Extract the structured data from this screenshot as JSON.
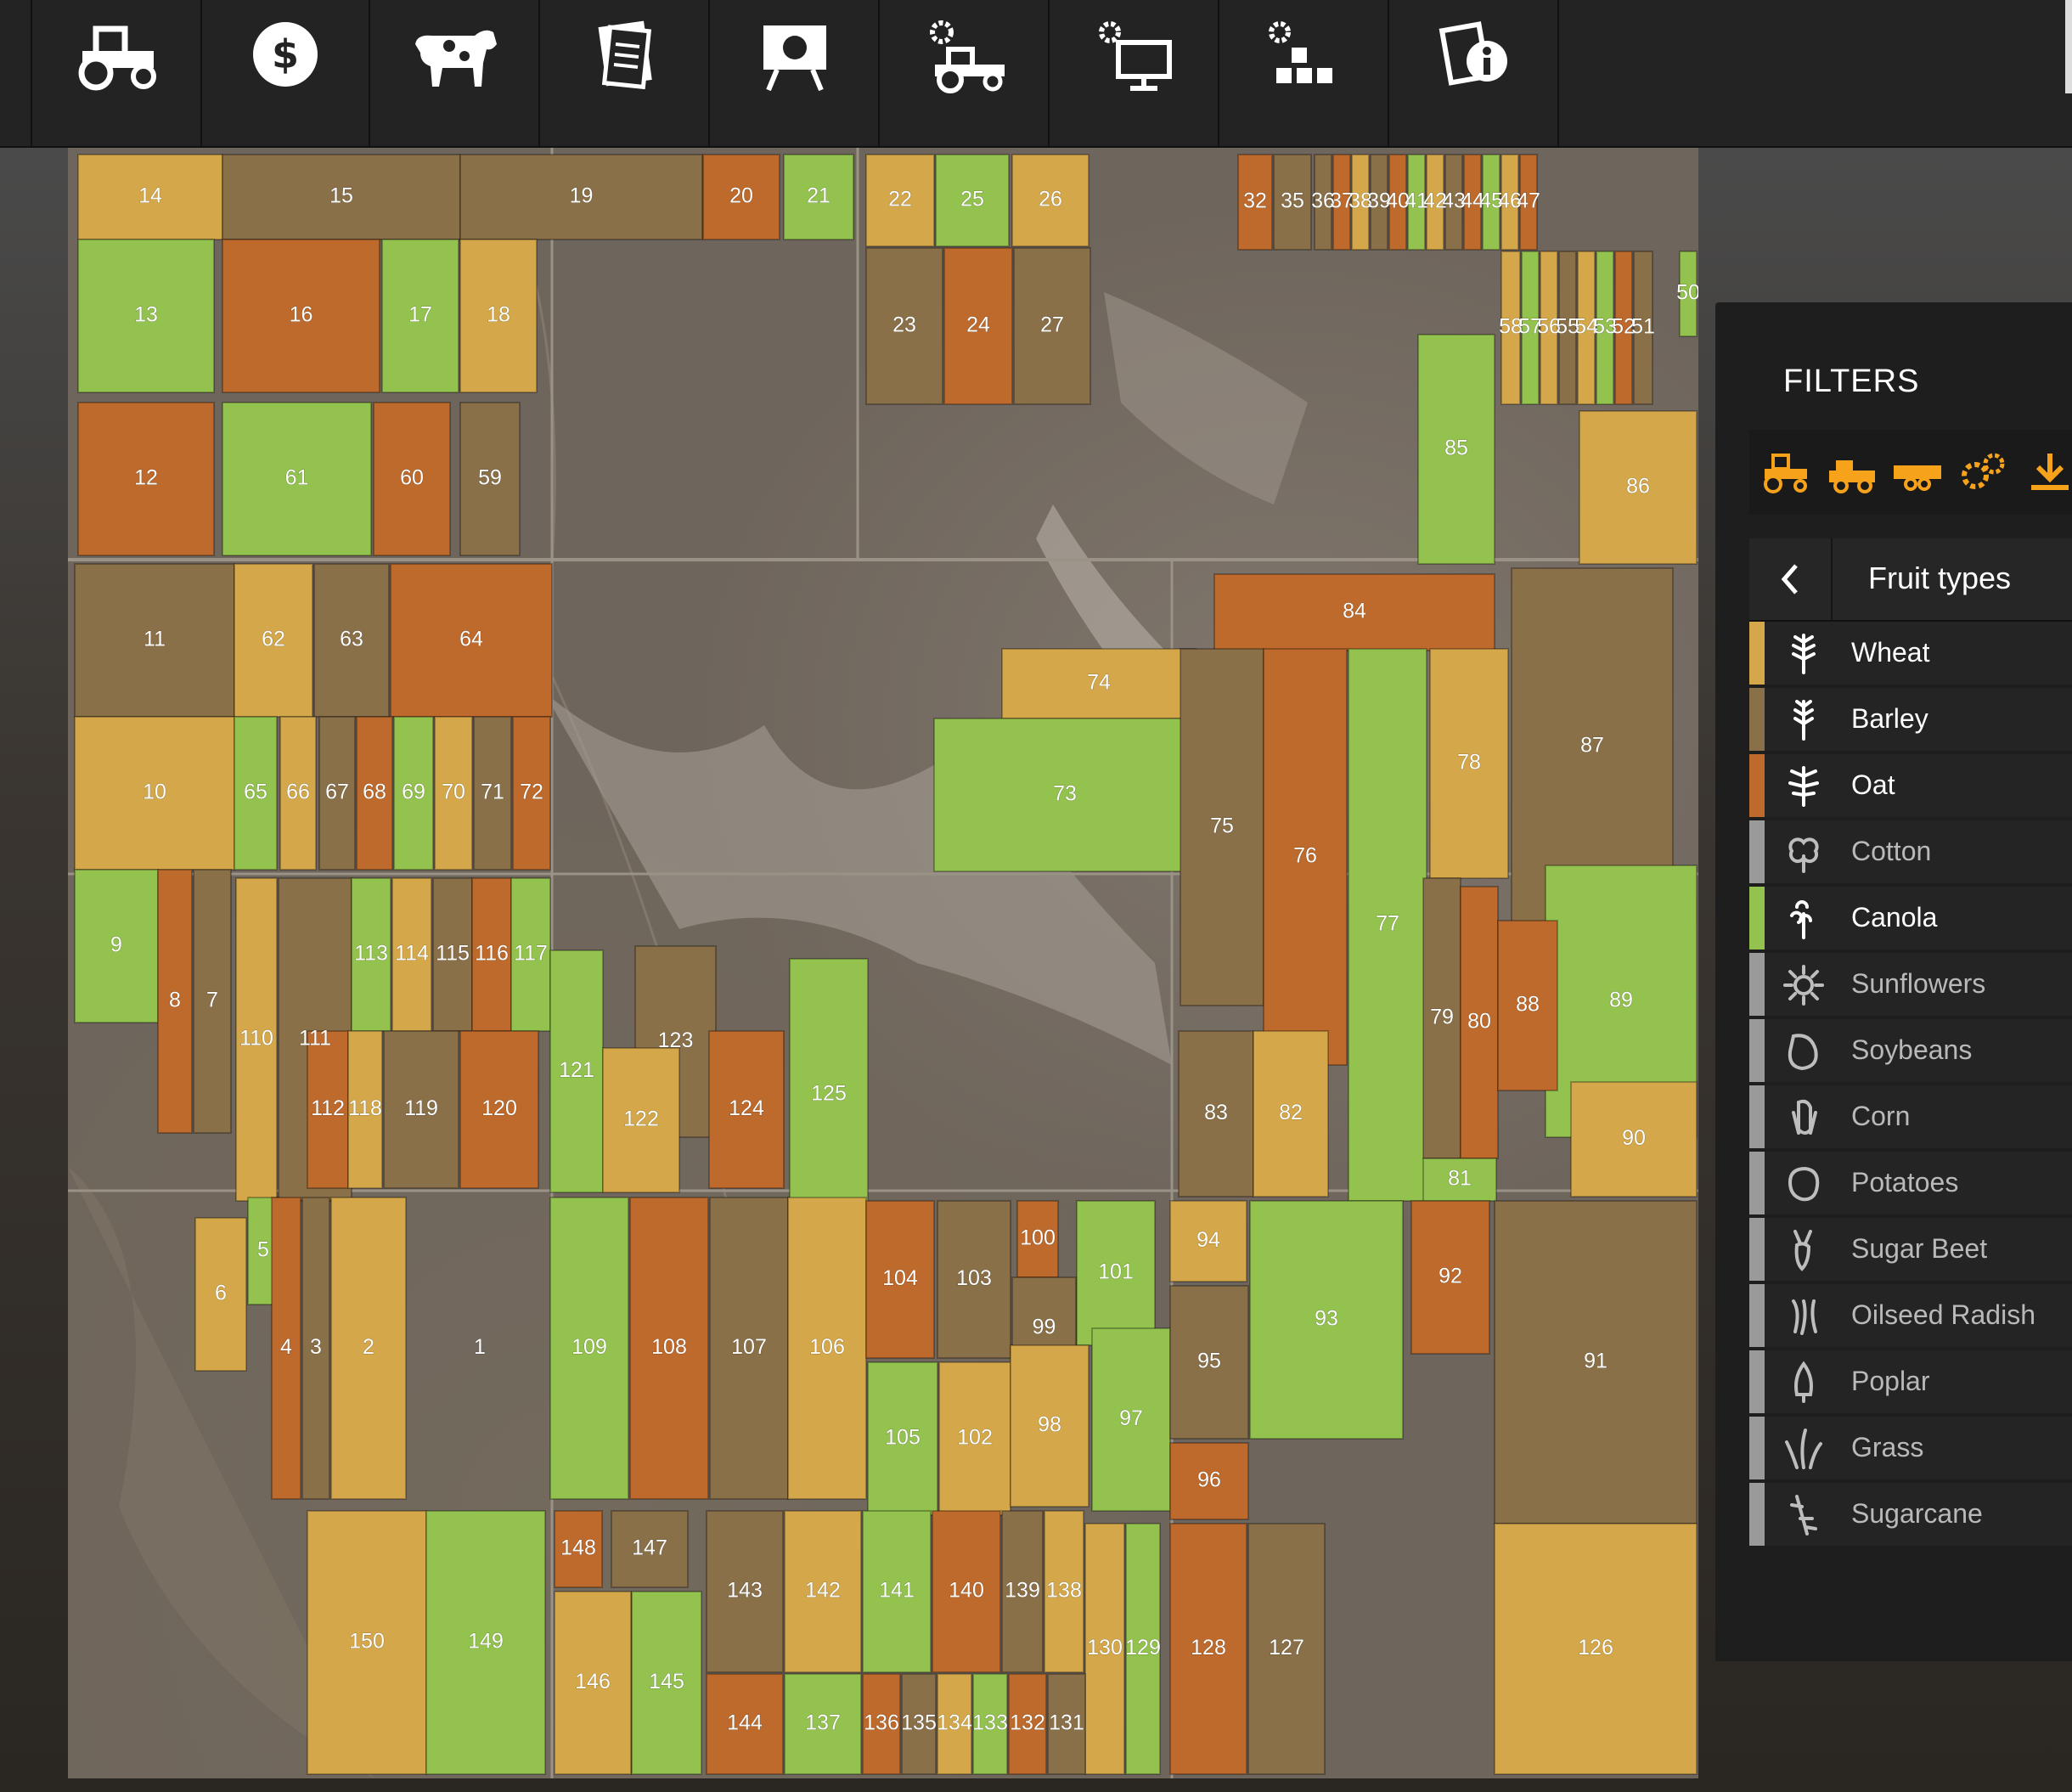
{
  "toolbar": {
    "buttons": [
      {
        "name": "vehicles-icon"
      },
      {
        "name": "finances-icon"
      },
      {
        "name": "animals-icon"
      },
      {
        "name": "contracts-icon"
      },
      {
        "name": "statistics-icon"
      },
      {
        "name": "garage-icon"
      },
      {
        "name": "production-icon"
      },
      {
        "name": "construction-icon"
      },
      {
        "name": "help-icon"
      }
    ]
  },
  "filters": {
    "title": "FILTERS",
    "icons": [
      "tractor-icon",
      "harvester-icon",
      "trailer-icon",
      "gears-icon",
      "download-icon"
    ],
    "icon_color": "#f7a21b",
    "fruit_header": {
      "title": "Fruit types"
    },
    "fruit_types": [
      {
        "label": "Wheat",
        "color": "#d4a84a",
        "active": true,
        "icon": "wheat-icon"
      },
      {
        "label": "Barley",
        "color": "#8a7048",
        "active": true,
        "icon": "barley-icon"
      },
      {
        "label": "Oat",
        "color": "#bd6a2c",
        "active": true,
        "icon": "oat-icon"
      },
      {
        "label": "Cotton",
        "color": "#9a9a9a",
        "active": false,
        "icon": "cotton-icon"
      },
      {
        "label": "Canola",
        "color": "#93c24f",
        "active": true,
        "icon": "canola-icon"
      },
      {
        "label": "Sunflowers",
        "color": "#9a9a9a",
        "active": false,
        "icon": "sunflower-icon"
      },
      {
        "label": "Soybeans",
        "color": "#9a9a9a",
        "active": false,
        "icon": "soybean-icon"
      },
      {
        "label": "Corn",
        "color": "#9a9a9a",
        "active": false,
        "icon": "corn-icon"
      },
      {
        "label": "Potatoes",
        "color": "#9a9a9a",
        "active": false,
        "icon": "potato-icon"
      },
      {
        "label": "Sugar Beet",
        "color": "#9a9a9a",
        "active": false,
        "icon": "sugarbeet-icon"
      },
      {
        "label": "Oilseed Radish",
        "color": "#9a9a9a",
        "active": false,
        "icon": "radish-icon"
      },
      {
        "label": "Poplar",
        "color": "#9a9a9a",
        "active": false,
        "icon": "poplar-icon"
      },
      {
        "label": "Grass",
        "color": "#9a9a9a",
        "active": false,
        "icon": "grass-icon"
      },
      {
        "label": "Sugarcane",
        "color": "#9a9a9a",
        "active": false,
        "icon": "sugarcane-icon"
      }
    ]
  },
  "map": {
    "fields": [
      {
        "id": "14",
        "crop": "W"
      },
      {
        "id": "15",
        "crop": "B"
      },
      {
        "id": "19",
        "crop": "B"
      },
      {
        "id": "20",
        "crop": "O"
      },
      {
        "id": "21",
        "crop": "C"
      },
      {
        "id": "22",
        "crop": "W"
      },
      {
        "id": "25",
        "crop": "C"
      },
      {
        "id": "26",
        "crop": "W"
      },
      {
        "id": "13",
        "crop": "C"
      },
      {
        "id": "16",
        "crop": "O"
      },
      {
        "id": "17",
        "crop": "C"
      },
      {
        "id": "18",
        "crop": "W"
      },
      {
        "id": "23",
        "crop": "B"
      },
      {
        "id": "24",
        "crop": "O"
      },
      {
        "id": "27",
        "crop": "B"
      },
      {
        "id": "12",
        "crop": "O"
      },
      {
        "id": "61",
        "crop": "C"
      },
      {
        "id": "60",
        "crop": "O"
      },
      {
        "id": "59",
        "crop": "B"
      },
      {
        "id": "32",
        "crop": "O"
      },
      {
        "id": "35",
        "crop": "B"
      },
      {
        "id": "36",
        "crop": "B"
      },
      {
        "id": "37",
        "crop": "O"
      },
      {
        "id": "38",
        "crop": "W"
      },
      {
        "id": "39",
        "crop": "B"
      },
      {
        "id": "40",
        "crop": "O"
      },
      {
        "id": "41",
        "crop": "C"
      },
      {
        "id": "42",
        "crop": "W"
      },
      {
        "id": "43",
        "crop": "B"
      },
      {
        "id": "44",
        "crop": "O"
      },
      {
        "id": "45",
        "crop": "C"
      },
      {
        "id": "46",
        "crop": "W"
      },
      {
        "id": "47",
        "crop": "O"
      },
      {
        "id": "50",
        "crop": "C"
      },
      {
        "id": "58",
        "crop": "W"
      },
      {
        "id": "57",
        "crop": "C"
      },
      {
        "id": "56",
        "crop": "W"
      },
      {
        "id": "55",
        "crop": "B"
      },
      {
        "id": "54",
        "crop": "W"
      },
      {
        "id": "53",
        "crop": "C"
      },
      {
        "id": "52",
        "crop": "O"
      },
      {
        "id": "51",
        "crop": "B"
      },
      {
        "id": "85",
        "crop": "C"
      },
      {
        "id": "86",
        "crop": "W"
      },
      {
        "id": "11",
        "crop": "B"
      },
      {
        "id": "62",
        "crop": "W"
      },
      {
        "id": "63",
        "crop": "B"
      },
      {
        "id": "64",
        "crop": "O"
      },
      {
        "id": "84",
        "crop": "O"
      },
      {
        "id": "10",
        "crop": "W"
      },
      {
        "id": "65",
        "crop": "C"
      },
      {
        "id": "66",
        "crop": "W"
      },
      {
        "id": "67",
        "crop": "B"
      },
      {
        "id": "68",
        "crop": "O"
      },
      {
        "id": "69",
        "crop": "C"
      },
      {
        "id": "70",
        "crop": "W"
      },
      {
        "id": "71",
        "crop": "B"
      },
      {
        "id": "72",
        "crop": "O"
      },
      {
        "id": "74",
        "crop": "W"
      },
      {
        "id": "73",
        "crop": "C"
      },
      {
        "id": "75",
        "crop": "B"
      },
      {
        "id": "76",
        "crop": "O"
      },
      {
        "id": "77",
        "crop": "C"
      },
      {
        "id": "78",
        "crop": "W"
      },
      {
        "id": "87",
        "crop": "B"
      },
      {
        "id": "89",
        "crop": "C"
      },
      {
        "id": "9",
        "crop": "C"
      },
      {
        "id": "8",
        "crop": "O"
      },
      {
        "id": "7",
        "crop": "B"
      },
      {
        "id": "110",
        "crop": "W"
      },
      {
        "id": "111",
        "crop": "B"
      },
      {
        "id": "113",
        "crop": "C"
      },
      {
        "id": "114",
        "crop": "W"
      },
      {
        "id": "115",
        "crop": "B"
      },
      {
        "id": "116",
        "crop": "O"
      },
      {
        "id": "117",
        "crop": "C"
      },
      {
        "id": "123",
        "crop": "B"
      },
      {
        "id": "125",
        "crop": "C"
      },
      {
        "id": "79",
        "crop": "B"
      },
      {
        "id": "80",
        "crop": "O"
      },
      {
        "id": "88",
        "crop": "O"
      },
      {
        "id": "112",
        "crop": "O"
      },
      {
        "id": "118",
        "crop": "W"
      },
      {
        "id": "119",
        "crop": "B"
      },
      {
        "id": "120",
        "crop": "O"
      },
      {
        "id": "121",
        "crop": "C"
      },
      {
        "id": "122",
        "crop": "W"
      },
      {
        "id": "124",
        "crop": "O"
      },
      {
        "id": "83",
        "crop": "B"
      },
      {
        "id": "82",
        "crop": "W"
      },
      {
        "id": "81",
        "crop": "C"
      },
      {
        "id": "90",
        "crop": "W"
      },
      {
        "id": "6",
        "crop": "W"
      },
      {
        "id": "5",
        "crop": "C"
      },
      {
        "id": "4",
        "crop": "O"
      },
      {
        "id": "3",
        "crop": "B"
      },
      {
        "id": "2",
        "crop": "W"
      },
      {
        "id": "1",
        "crop": "N"
      },
      {
        "id": "109",
        "crop": "C"
      },
      {
        "id": "108",
        "crop": "O"
      },
      {
        "id": "107",
        "crop": "B"
      },
      {
        "id": "106",
        "crop": "W"
      },
      {
        "id": "104",
        "crop": "O"
      },
      {
        "id": "103",
        "crop": "B"
      },
      {
        "id": "100",
        "crop": "O"
      },
      {
        "id": "99",
        "crop": "B"
      },
      {
        "id": "101",
        "crop": "C"
      },
      {
        "id": "94",
        "crop": "W"
      },
      {
        "id": "93",
        "crop": "C"
      },
      {
        "id": "92",
        "crop": "O"
      },
      {
        "id": "91",
        "crop": "B"
      },
      {
        "id": "105",
        "crop": "C"
      },
      {
        "id": "102",
        "crop": "W"
      },
      {
        "id": "98",
        "crop": "W"
      },
      {
        "id": "97",
        "crop": "C"
      },
      {
        "id": "95",
        "crop": "B"
      },
      {
        "id": "96",
        "crop": "O"
      },
      {
        "id": "150",
        "crop": "W"
      },
      {
        "id": "149",
        "crop": "C"
      },
      {
        "id": "148",
        "crop": "O"
      },
      {
        "id": "147",
        "crop": "B"
      },
      {
        "id": "146",
        "crop": "W"
      },
      {
        "id": "145",
        "crop": "C"
      },
      {
        "id": "143",
        "crop": "B"
      },
      {
        "id": "142",
        "crop": "W"
      },
      {
        "id": "141",
        "crop": "C"
      },
      {
        "id": "140",
        "crop": "O"
      },
      {
        "id": "139",
        "crop": "B"
      },
      {
        "id": "138",
        "crop": "W"
      },
      {
        "id": "130",
        "crop": "W"
      },
      {
        "id": "129",
        "crop": "C"
      },
      {
        "id": "128",
        "crop": "O"
      },
      {
        "id": "127",
        "crop": "B"
      },
      {
        "id": "126",
        "crop": "W"
      },
      {
        "id": "144",
        "crop": "O"
      },
      {
        "id": "137",
        "crop": "C"
      },
      {
        "id": "136",
        "crop": "O"
      },
      {
        "id": "135",
        "crop": "B"
      },
      {
        "id": "134",
        "crop": "W"
      },
      {
        "id": "133",
        "crop": "C"
      },
      {
        "id": "132",
        "crop": "O"
      },
      {
        "id": "131",
        "crop": "B"
      }
    ]
  }
}
